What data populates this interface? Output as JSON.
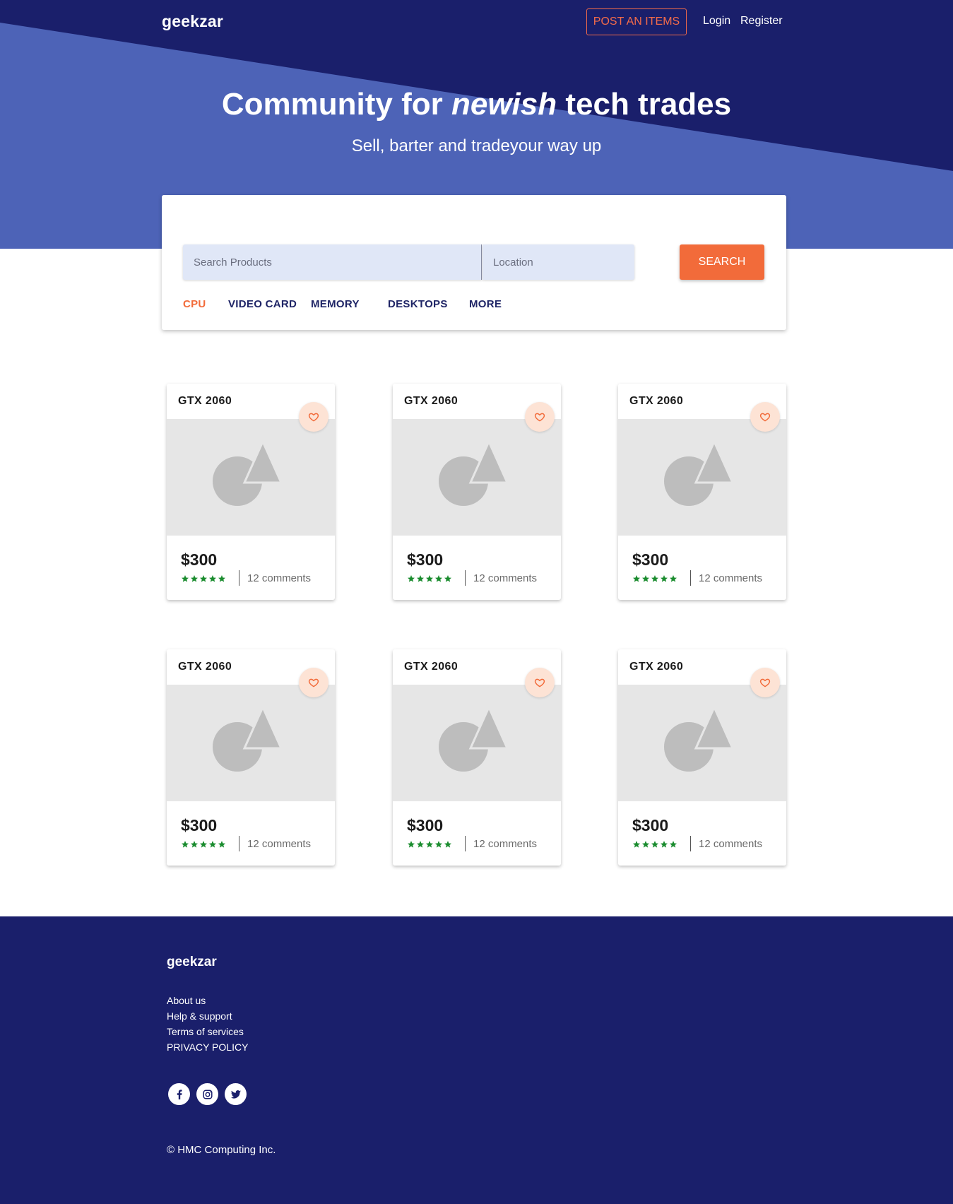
{
  "header": {
    "logo": "geekzar",
    "post_button": "POST AN ITEMS",
    "login": "Login",
    "register": "Register"
  },
  "hero": {
    "title_part1": "Community for ",
    "title_emphasis": "newish",
    "title_part2": " tech trades",
    "subtitle": "Sell, barter and tradeyour way up"
  },
  "search": {
    "product_placeholder": "Search Products",
    "location_placeholder": "Location",
    "button": "SEARCH",
    "categories": [
      {
        "label": "CPU",
        "active": true
      },
      {
        "label": "VIDEO CARD",
        "active": false
      },
      {
        "label": "MEMORY",
        "active": false
      },
      {
        "label": "DESKTOPS",
        "active": false
      },
      {
        "label": "MORE",
        "active": false
      }
    ]
  },
  "products": [
    {
      "title": "GTX 2060",
      "price": "$300",
      "rating": 5,
      "comments": "12 comments"
    },
    {
      "title": "GTX 2060",
      "price": "$300",
      "rating": 5,
      "comments": "12 comments"
    },
    {
      "title": "GTX 2060",
      "price": "$300",
      "rating": 5,
      "comments": "12 comments"
    },
    {
      "title": "GTX 2060",
      "price": "$300",
      "rating": 5,
      "comments": "12 comments"
    },
    {
      "title": "GTX 2060",
      "price": "$300",
      "rating": 5,
      "comments": "12 comments"
    },
    {
      "title": "GTX 2060",
      "price": "$300",
      "rating": 5,
      "comments": "12 comments"
    }
  ],
  "footer": {
    "logo": "geekzar",
    "links": [
      "About us",
      "Help & support",
      "Terms of services",
      "PRIVACY POLICY"
    ],
    "socials": [
      "facebook-icon",
      "instagram-icon",
      "twitter-icon"
    ],
    "copyright": "© HMC Computing Inc."
  },
  "colors": {
    "navy": "#1a1f6b",
    "hero_blue": "#4d63b7",
    "accent_orange": "#f26b3a",
    "star_green": "#1a8c2e",
    "heart_bg": "#fde3d5"
  }
}
